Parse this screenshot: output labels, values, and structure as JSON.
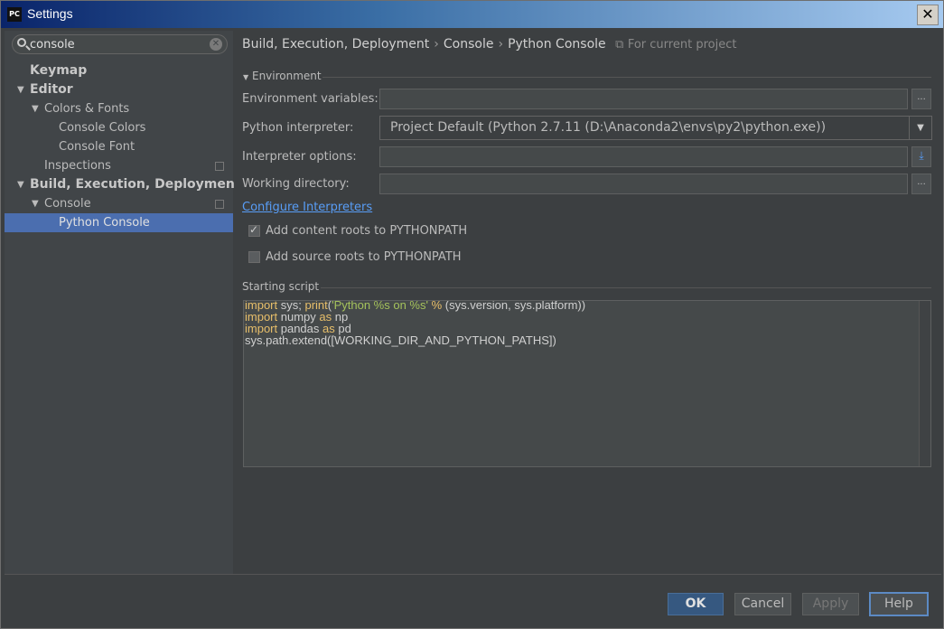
{
  "window": {
    "title": "Settings",
    "close_glyph": "✕",
    "app_icon": "PC"
  },
  "search": {
    "value": "console",
    "clear_icon": "clear-search-icon"
  },
  "tree": [
    {
      "label": "Keymap",
      "level": 0,
      "bold": true
    },
    {
      "label": "Editor",
      "level": 0,
      "bold": true,
      "expanded": true
    },
    {
      "label": "Colors & Fonts",
      "level": 1,
      "expanded": true
    },
    {
      "label": "Console Colors",
      "level": 2
    },
    {
      "label": "Console Font",
      "level": 2
    },
    {
      "label": "Inspections",
      "level": 1,
      "project_icon": true
    },
    {
      "label": "Build, Execution, Deployment",
      "level": 0,
      "bold": true,
      "expanded": true
    },
    {
      "label": "Console",
      "level": 1,
      "expanded": true,
      "project_icon": true
    },
    {
      "label": "Python Console",
      "level": 2,
      "selected": true
    }
  ],
  "breadcrumb": {
    "part1": "Build, Execution, Deployment",
    "part2": "Console",
    "part3": "Python Console",
    "scope": "For current project",
    "sep": "›"
  },
  "environment": {
    "section_label": "Environment",
    "env_vars_label": "Environment variables:",
    "env_vars_value": "",
    "interpreter_label": "Python interpreter:",
    "interpreter_value": "Project Default (Python 2.7.11 (D:\\Anaconda2\\envs\\py2\\python.exe))",
    "options_label": "Interpreter options:",
    "options_value": "",
    "workdir_label": "Working directory:",
    "workdir_value": "",
    "browse_glyph": "...",
    "configure_link": "Configure Interpreters",
    "add_content_roots": {
      "label": "Add content roots to PYTHONPATH",
      "checked": true
    },
    "add_source_roots": {
      "label": "Add source roots to PYTHONPATH",
      "checked": false
    }
  },
  "starting_script": {
    "label": "Starting script",
    "lines": [
      "import sys; print('Python %s on %s' % (sys.version, sys.platform))",
      "import numpy as np",
      "import pandas as pd",
      "sys.path.extend([WORKING_DIR_AND_PYTHON_PATHS])"
    ]
  },
  "buttons": {
    "ok": "OK",
    "cancel": "Cancel",
    "apply": "Apply",
    "help": "Help"
  },
  "colors": {
    "selection": "#4b6eaf",
    "link": "#589df6",
    "keyword": "#e8bf6a",
    "string": "#a5c25c"
  }
}
